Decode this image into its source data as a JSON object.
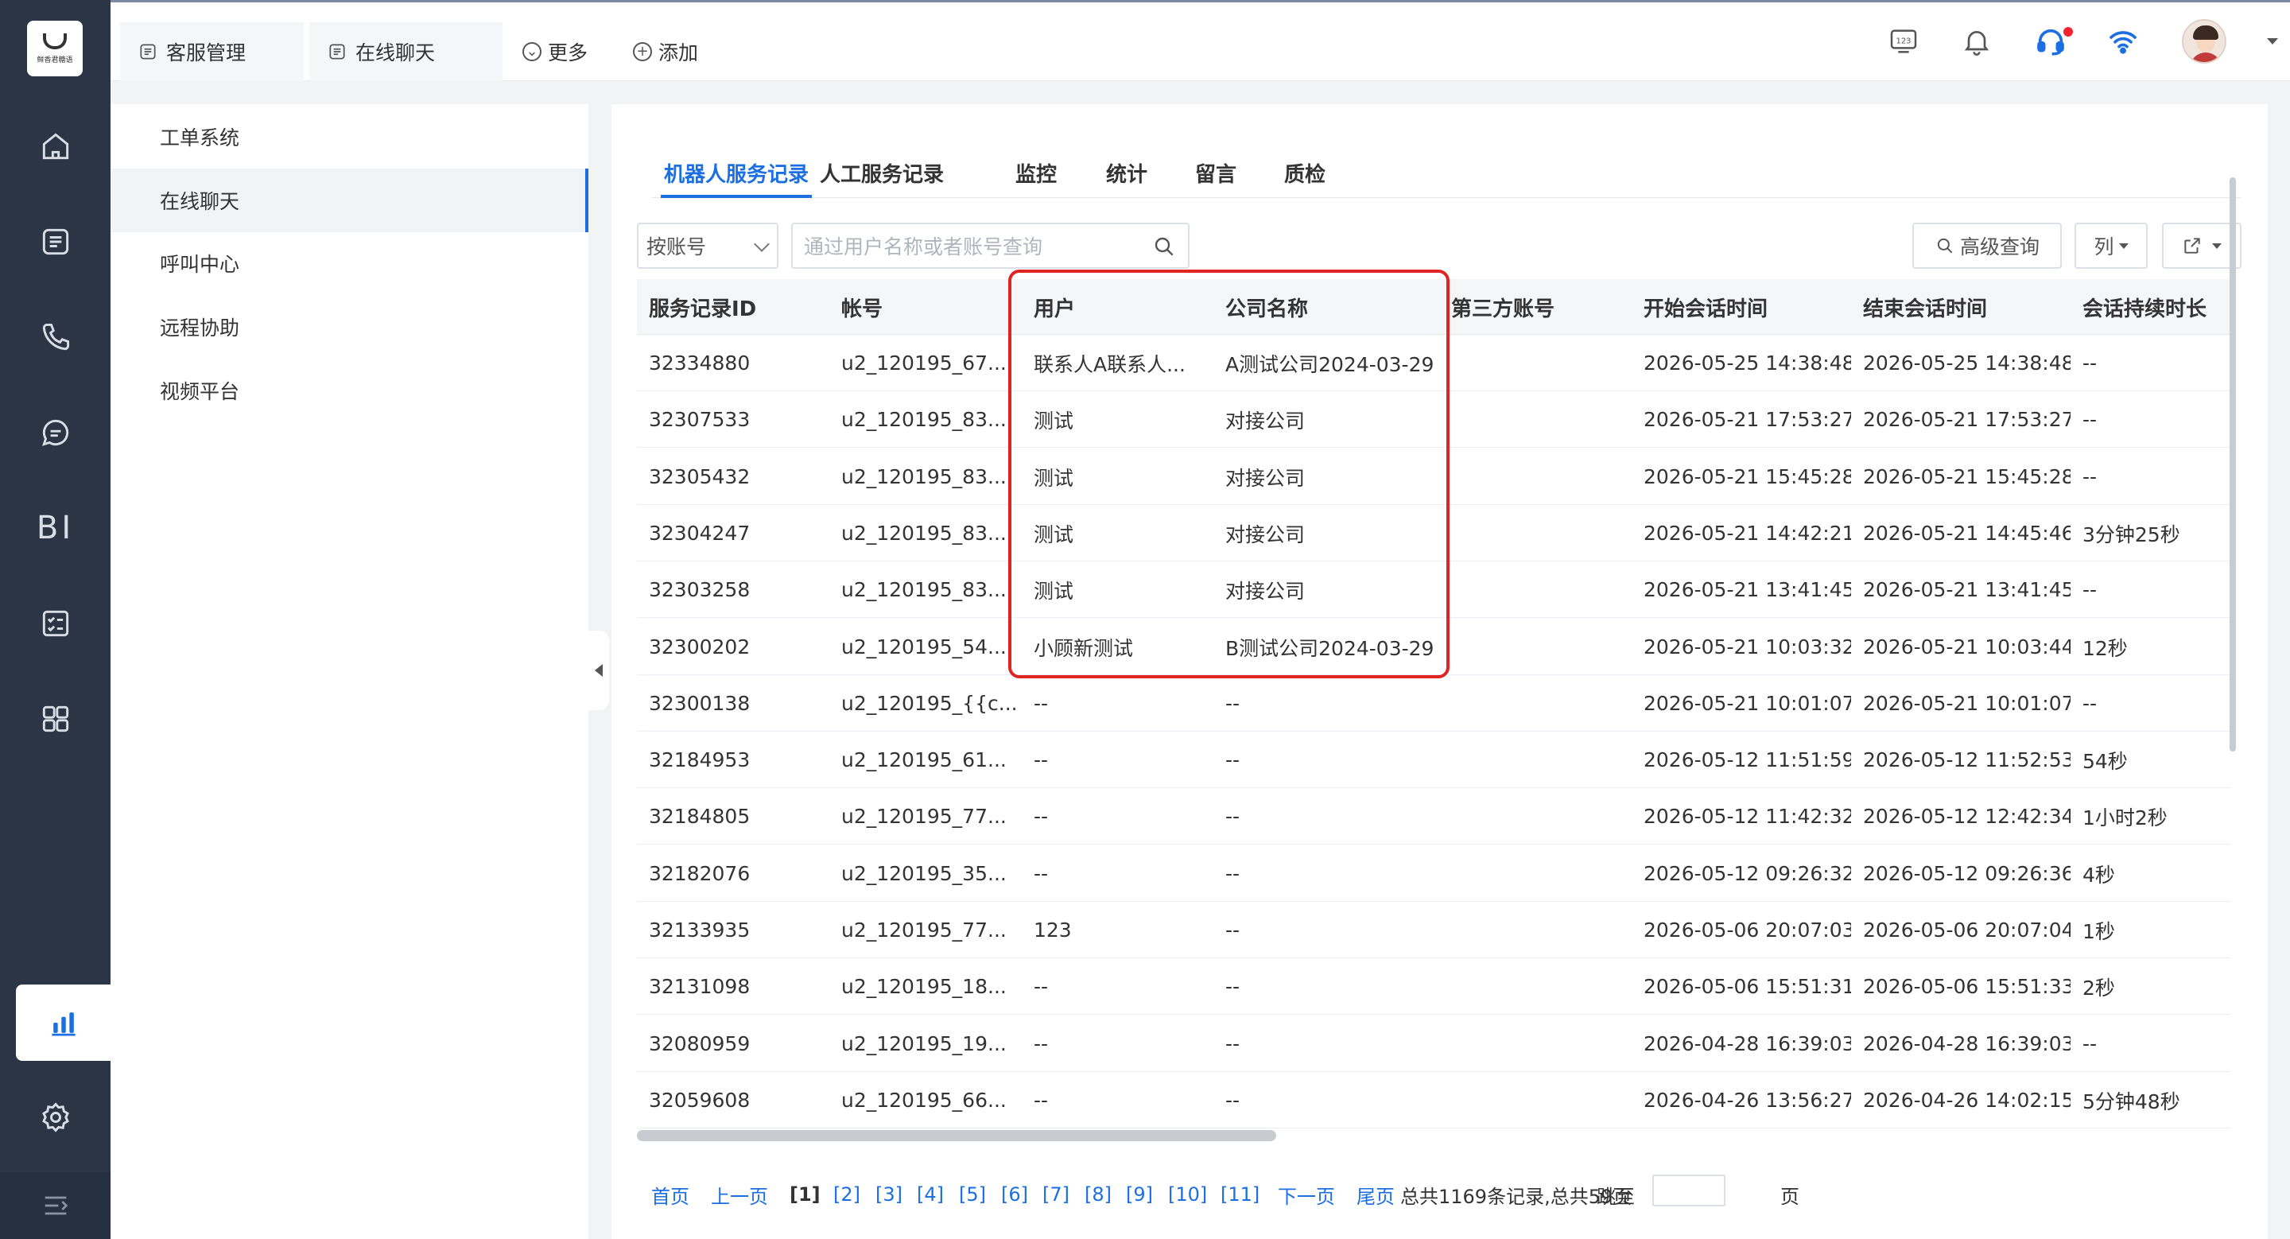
{
  "logo": {
    "text": "鲜香君糖语"
  },
  "rail": {
    "items": [
      {
        "name": "home-icon"
      },
      {
        "name": "document-icon"
      },
      {
        "name": "phone-icon"
      },
      {
        "name": "chat-icon"
      },
      {
        "name": "bi-icon",
        "label": "BI"
      },
      {
        "name": "checklist-icon"
      },
      {
        "name": "apps-icon"
      },
      {
        "name": "bar-chart-icon",
        "active": true
      },
      {
        "name": "settings-icon"
      }
    ]
  },
  "topbar": {
    "tabs": [
      {
        "label": "客服管理"
      },
      {
        "label": "在线聊天"
      }
    ],
    "more_label": "更多",
    "add_label": "添加",
    "accent": "#1c6fe2"
  },
  "submenu": {
    "items": [
      {
        "label": "工单系统"
      },
      {
        "label": "在线聊天",
        "active": true
      },
      {
        "label": "呼叫中心"
      },
      {
        "label": "远程协助"
      },
      {
        "label": "视频平台"
      }
    ]
  },
  "main": {
    "tabs": [
      {
        "label": "机器人服务记录",
        "active": true
      },
      {
        "label": "人工服务记录"
      },
      {
        "label": "监控"
      },
      {
        "label": "统计"
      },
      {
        "label": "留言"
      },
      {
        "label": "质检"
      }
    ],
    "filter_select": "按账号",
    "search_placeholder": "通过用户名称或者账号查询",
    "advanced_label": "高级查询",
    "columns_label": "列"
  },
  "table": {
    "headers": [
      "服务记录ID",
      "帐号",
      "用户",
      "公司名称",
      "第三方账号",
      "开始会话时间",
      "结束会话时间",
      "会话持续时长"
    ],
    "rows": [
      [
        "32334880",
        "u2_120195_67...",
        "联系人A联系人...",
        "A测试公司2024-03-29",
        "",
        "2026-05-25 14:38:48",
        "2026-05-25 14:38:48",
        "--"
      ],
      [
        "32307533",
        "u2_120195_83...",
        "测试",
        "对接公司",
        "",
        "2026-05-21 17:53:27",
        "2026-05-21 17:53:27",
        "--"
      ],
      [
        "32305432",
        "u2_120195_83...",
        "测试",
        "对接公司",
        "",
        "2026-05-21 15:45:28",
        "2026-05-21 15:45:28",
        "--"
      ],
      [
        "32304247",
        "u2_120195_83...",
        "测试",
        "对接公司",
        "",
        "2026-05-21 14:42:21",
        "2026-05-21 14:45:46",
        "3分钟25秒"
      ],
      [
        "32303258",
        "u2_120195_83...",
        "测试",
        "对接公司",
        "",
        "2026-05-21 13:41:45",
        "2026-05-21 13:41:45",
        "--"
      ],
      [
        "32300202",
        "u2_120195_54...",
        "小顾新测试",
        "B测试公司2024-03-29",
        "",
        "2026-05-21 10:03:32",
        "2026-05-21 10:03:44",
        "12秒"
      ],
      [
        "32300138",
        "u2_120195_{{c...",
        "--",
        "--",
        "",
        "2026-05-21 10:01:07",
        "2026-05-21 10:01:07",
        "--"
      ],
      [
        "32184953",
        "u2_120195_61...",
        "--",
        "--",
        "",
        "2026-05-12 11:51:59",
        "2026-05-12 11:52:53",
        "54秒"
      ],
      [
        "32184805",
        "u2_120195_77...",
        "--",
        "--",
        "",
        "2026-05-12 11:42:32",
        "2026-05-12 12:42:34",
        "1小时2秒"
      ],
      [
        "32182076",
        "u2_120195_35...",
        "--",
        "--",
        "",
        "2026-05-12 09:26:32",
        "2026-05-12 09:26:36",
        "4秒"
      ],
      [
        "32133935",
        "u2_120195_77...",
        "123",
        "--",
        "",
        "2026-05-06 20:07:03",
        "2026-05-06 20:07:04",
        "1秒"
      ],
      [
        "32131098",
        "u2_120195_18...",
        "--",
        "--",
        "",
        "2026-05-06 15:51:31",
        "2026-05-06 15:51:33",
        "2秒"
      ],
      [
        "32080959",
        "u2_120195_19...",
        "--",
        "--",
        "",
        "2026-04-28 16:39:03",
        "2026-04-28 16:39:03",
        "--"
      ],
      [
        "32059608",
        "u2_120195_66...",
        "--",
        "--",
        "",
        "2026-04-26 13:56:27",
        "2026-04-26 14:02:15",
        "5分钟48秒"
      ]
    ]
  },
  "pagination": {
    "first": "首页",
    "prev": "上一页",
    "pages": [
      "[1]",
      "[2]",
      "[3]",
      "[4]",
      "[5]",
      "[6]",
      "[7]",
      "[8]",
      "[9]",
      "[10]",
      "[11]"
    ],
    "current": "[1]",
    "next": "下一页",
    "last": "尾页",
    "summary": "总共1169条记录,总共59页",
    "jump_label": "跳至",
    "page_suffix": "页"
  },
  "colors": {
    "highlight": "#e02424",
    "rail_bg": "#2b3545"
  }
}
